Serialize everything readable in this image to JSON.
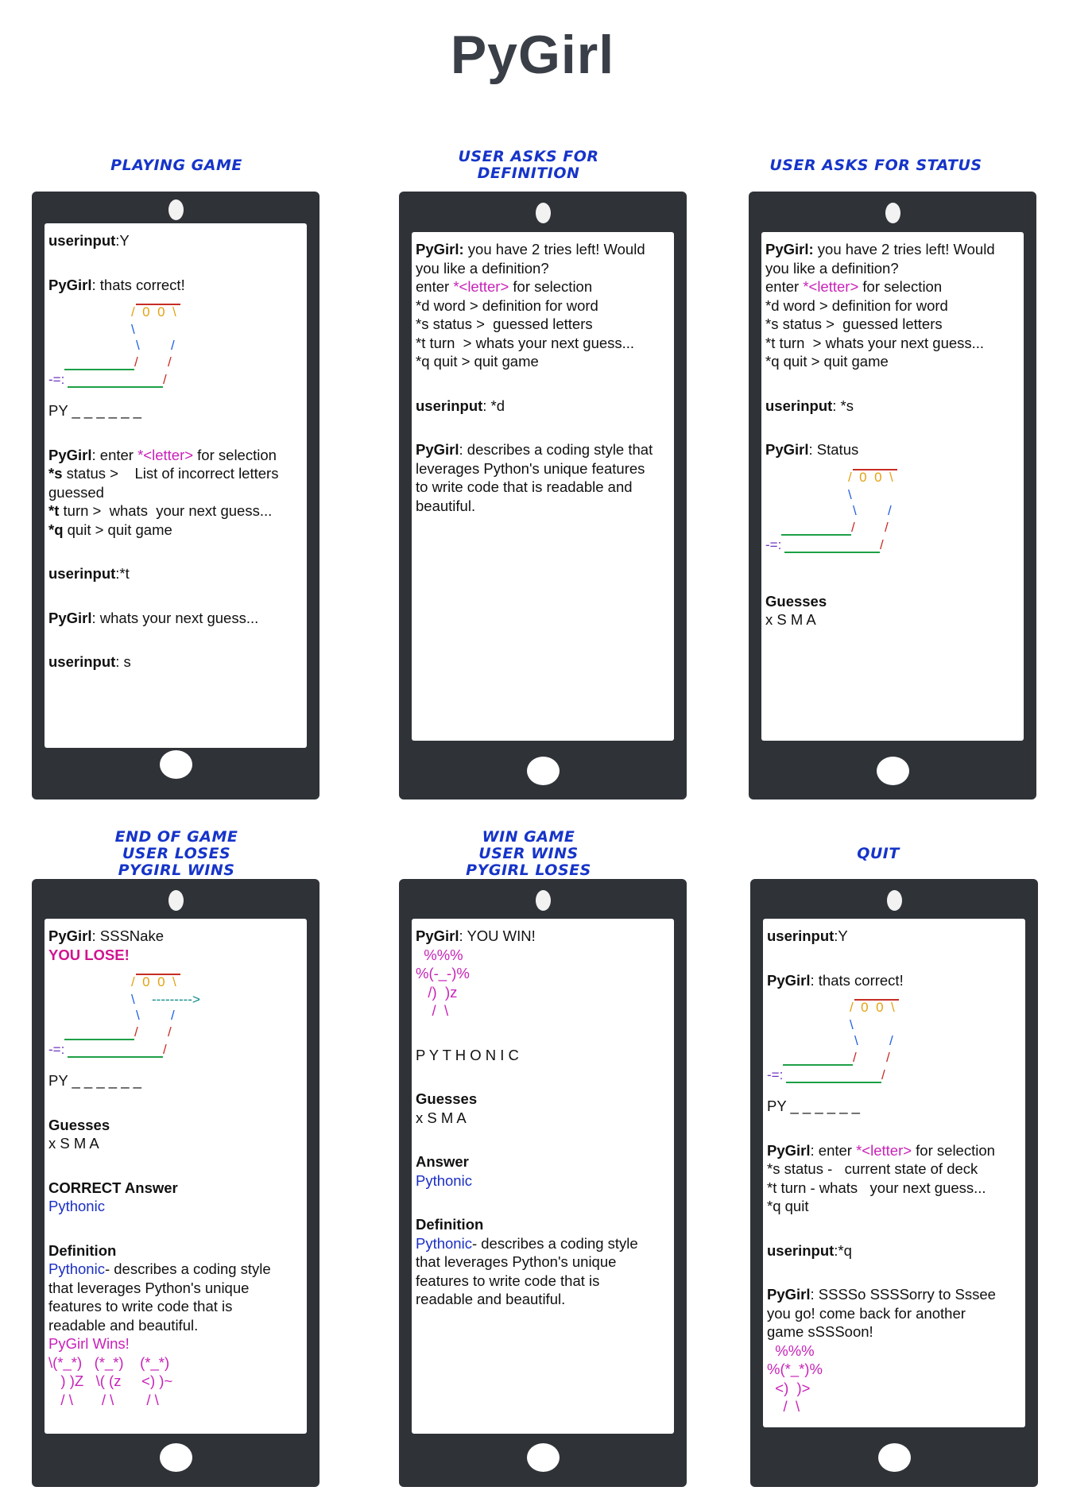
{
  "title": "PyGirl",
  "panels": [
    {
      "caption": [
        "PLAYING GAME"
      ],
      "lines": [
        {
          "t": [
            {
              "s": "userinput",
              "c": "b"
            },
            {
              "s": ":Y"
            }
          ]
        },
        {
          "gap": true
        },
        {
          "t": [
            {
              "s": "PyGirl",
              "c": "b"
            },
            {
              "s": ": thats correct!"
            }
          ]
        },
        {
          "art": "snake"
        },
        {
          "t": [
            {
              "s": "PY _ _ _ _ _ _"
            }
          ]
        },
        {
          "gap": true
        },
        {
          "t": [
            {
              "s": "PyGirl",
              "c": "b"
            },
            {
              "s": ": enter "
            },
            {
              "s": "*<letter>",
              "c": "mag"
            },
            {
              "s": " for selection"
            }
          ]
        },
        {
          "t": [
            {
              "s": "*s",
              "c": "b"
            },
            {
              "s": " status >    List of incorrect letters"
            }
          ]
        },
        {
          "t": [
            {
              "s": "guessed"
            }
          ]
        },
        {
          "t": [
            {
              "s": "*t",
              "c": "b"
            },
            {
              "s": " turn >  whats  your next guess..."
            }
          ]
        },
        {
          "t": [
            {
              "s": "*q",
              "c": "b"
            },
            {
              "s": " quit > quit game"
            }
          ]
        },
        {
          "gap": true
        },
        {
          "t": [
            {
              "s": "userinput",
              "c": "b"
            },
            {
              "s": ":*t"
            }
          ]
        },
        {
          "gap": true
        },
        {
          "t": [
            {
              "s": "PyGirl",
              "c": "b"
            },
            {
              "s": ": whats your next guess..."
            }
          ]
        },
        {
          "gap": true
        },
        {
          "t": [
            {
              "s": "userinput",
              "c": "b"
            },
            {
              "s": ": s"
            }
          ]
        }
      ]
    },
    {
      "caption": [
        "USER ASKS FOR",
        "DEFINITION"
      ],
      "lines": [
        {
          "t": [
            {
              "s": "PyGirl:",
              "c": "b"
            },
            {
              "s": " you have 2 tries left! Would"
            }
          ]
        },
        {
          "t": [
            {
              "s": "you like a definition?"
            }
          ]
        },
        {
          "t": [
            {
              "s": "enter "
            },
            {
              "s": "*<letter>",
              "c": "mag"
            },
            {
              "s": " for selection"
            }
          ]
        },
        {
          "t": [
            {
              "s": "*d word > definition for word"
            }
          ]
        },
        {
          "t": [
            {
              "s": "*s status >  guessed letters"
            }
          ]
        },
        {
          "t": [
            {
              "s": "*t turn  > whats your next guess..."
            }
          ]
        },
        {
          "t": [
            {
              "s": "*q quit > quit game"
            }
          ]
        },
        {
          "gap": true
        },
        {
          "t": [
            {
              "s": "userinput",
              "c": "b"
            },
            {
              "s": ": *d"
            }
          ]
        },
        {
          "gap": true
        },
        {
          "t": [
            {
              "s": "PyGirl",
              "c": "b"
            },
            {
              "s": ": describes a coding style that"
            }
          ]
        },
        {
          "t": [
            {
              "s": "leverages Python's unique features"
            }
          ]
        },
        {
          "t": [
            {
              "s": "to write code that is readable and"
            }
          ]
        },
        {
          "t": [
            {
              "s": "beautiful."
            }
          ]
        }
      ]
    },
    {
      "caption": [
        "USER ASKS FOR STATUS"
      ],
      "lines": [
        {
          "t": [
            {
              "s": "PyGirl:",
              "c": "b"
            },
            {
              "s": " you have 2 tries left! Would"
            }
          ]
        },
        {
          "t": [
            {
              "s": "you like a definition?"
            }
          ]
        },
        {
          "t": [
            {
              "s": "enter "
            },
            {
              "s": "*<letter>",
              "c": "mag"
            },
            {
              "s": " for selection"
            }
          ]
        },
        {
          "t": [
            {
              "s": "*d word > definition for word"
            }
          ]
        },
        {
          "t": [
            {
              "s": "*s status >  guessed letters"
            }
          ]
        },
        {
          "t": [
            {
              "s": "*t turn  > whats your next guess..."
            }
          ]
        },
        {
          "t": [
            {
              "s": "*q quit > quit game"
            }
          ]
        },
        {
          "gap": true
        },
        {
          "t": [
            {
              "s": "userinput",
              "c": "b"
            },
            {
              "s": ": *s"
            }
          ]
        },
        {
          "gap": true
        },
        {
          "t": [
            {
              "s": "PyGirl",
              "c": "b"
            },
            {
              "s": ": Status"
            }
          ]
        },
        {
          "art": "snake"
        },
        {
          "gap": true
        },
        {
          "t": [
            {
              "s": "Guesses",
              "c": "b"
            }
          ]
        },
        {
          "t": [
            {
              "s": "x S M A"
            }
          ]
        }
      ]
    },
    {
      "caption": [
        "END OF GAME",
        "USER LOSES",
        "PYGIRL WINS"
      ],
      "lines": [
        {
          "t": [
            {
              "s": "PyGirl",
              "c": "b"
            },
            {
              "s": ": SSSNake"
            }
          ]
        },
        {
          "t": [
            {
              "s": "YOU LOSE!",
              "c": "lose"
            }
          ]
        },
        {
          "art": "tongue"
        },
        {
          "t": [
            {
              "s": "PY _ _ _ _ _ _"
            }
          ]
        },
        {
          "gap": true
        },
        {
          "t": [
            {
              "s": "Guesses",
              "c": "b"
            }
          ]
        },
        {
          "t": [
            {
              "s": "x S M A"
            }
          ]
        },
        {
          "gap": true
        },
        {
          "t": [
            {
              "s": "CORRECT Answer",
              "c": "b"
            }
          ]
        },
        {
          "t": [
            {
              "s": "Pythonic",
              "c": "blue"
            }
          ]
        },
        {
          "gap": true
        },
        {
          "t": [
            {
              "s": "Definition",
              "c": "b"
            }
          ]
        },
        {
          "t": [
            {
              "s": "Pythonic",
              "c": "blue"
            },
            {
              "s": "- describes a coding style"
            }
          ]
        },
        {
          "t": [
            {
              "s": "that leverages Python's unique"
            }
          ]
        },
        {
          "t": [
            {
              "s": "features to write code that is"
            }
          ]
        },
        {
          "t": [
            {
              "s": "readable and beautiful."
            }
          ]
        },
        {
          "t": [
            {
              "s": "PyGirl Wins!",
              "c": "mag"
            }
          ]
        },
        {
          "t": [
            {
              "s": "\\(*_*)   (*_*)    (*_*)",
              "c": "mag"
            }
          ]
        },
        {
          "t": [
            {
              "s": "   ) )Z   \\( (z     <) )~",
              "c": "mag"
            }
          ]
        },
        {
          "t": [
            {
              "s": "   / \\       / \\        / \\",
              "c": "mag"
            }
          ]
        }
      ]
    },
    {
      "caption": [
        "WIN GAME",
        "USER WINS",
        "PYGIRL LOSES"
      ],
      "lines": [
        {
          "t": [
            {
              "s": "PyGirl",
              "c": "b"
            },
            {
              "s": ": YOU WIN!"
            }
          ]
        },
        {
          "t": [
            {
              "s": "  %%%",
              "c": "mag"
            }
          ]
        },
        {
          "t": [
            {
              "s": "%(-_-)%",
              "c": "mag"
            }
          ]
        },
        {
          "t": [
            {
              "s": "   /)  )z",
              "c": "mag"
            }
          ]
        },
        {
          "t": [
            {
              "s": "    /  \\",
              "c": "mag"
            }
          ]
        },
        {
          "gap": true
        },
        {
          "t": [
            {
              "s": "P Y T H O N I C"
            }
          ]
        },
        {
          "gap": true
        },
        {
          "t": [
            {
              "s": "Guesses",
              "c": "b"
            }
          ]
        },
        {
          "t": [
            {
              "s": "x S M A"
            }
          ]
        },
        {
          "gap": true
        },
        {
          "t": [
            {
              "s": "Answer",
              "c": "b"
            }
          ]
        },
        {
          "t": [
            {
              "s": "Pythonic",
              "c": "blue"
            }
          ]
        },
        {
          "gap": true
        },
        {
          "t": [
            {
              "s": "Definition",
              "c": "b"
            }
          ]
        },
        {
          "t": [
            {
              "s": "Pythonic",
              "c": "blue"
            },
            {
              "s": "- describes a coding style"
            }
          ]
        },
        {
          "t": [
            {
              "s": "that leverages Python's unique"
            }
          ]
        },
        {
          "t": [
            {
              "s": "features to write code that is"
            }
          ]
        },
        {
          "t": [
            {
              "s": "readable and beautiful."
            }
          ]
        }
      ]
    },
    {
      "caption": [
        "QUIT"
      ],
      "lines": [
        {
          "t": [
            {
              "s": "userinput",
              "c": "b"
            },
            {
              "s": ":Y"
            }
          ]
        },
        {
          "gap": true
        },
        {
          "t": [
            {
              "s": "PyGirl",
              "c": "b"
            },
            {
              "s": ": thats correct!"
            }
          ]
        },
        {
          "art": "snake"
        },
        {
          "t": [
            {
              "s": "PY _ _ _ _ _ _"
            }
          ]
        },
        {
          "gap": true
        },
        {
          "t": [
            {
              "s": "PyGirl",
              "c": "b"
            },
            {
              "s": ": enter "
            },
            {
              "s": "*<letter>",
              "c": "mag"
            },
            {
              "s": " for selection"
            }
          ]
        },
        {
          "t": [
            {
              "s": "*s status -   current state of deck"
            }
          ]
        },
        {
          "t": [
            {
              "s": "*t turn - whats   your next guess..."
            }
          ]
        },
        {
          "t": [
            {
              "s": "*q quit"
            }
          ]
        },
        {
          "gap": true
        },
        {
          "t": [
            {
              "s": "userinput",
              "c": "b"
            },
            {
              "s": ":*q"
            }
          ]
        },
        {
          "gap": true
        },
        {
          "t": [
            {
              "s": "PyGirl",
              "c": "b"
            },
            {
              "s": ": SSSSo SSSSorry to Sssee"
            }
          ]
        },
        {
          "t": [
            {
              "s": "you go! come back for another"
            }
          ]
        },
        {
          "t": [
            {
              "s": "game sSSSoon!"
            }
          ]
        },
        {
          "t": [
            {
              "s": "  %%%",
              "c": "mag"
            }
          ]
        },
        {
          "t": [
            {
              "s": "%(*_*)%",
              "c": "mag"
            }
          ]
        },
        {
          "t": [
            {
              "s": "  <)  )>",
              "c": "mag"
            }
          ]
        },
        {
          "t": [
            {
              "s": "    /  \\",
              "c": "mag"
            }
          ]
        }
      ]
    }
  ],
  "art": {
    "head": "/  0  0  \\",
    "neck": "\\",
    "tongue": "--------->",
    "bodyL": "\\",
    "bodyR": "/",
    "turnL": "/",
    "turnR": "/",
    "tail": "-=:",
    "colors": {
      "yellow": "#e3a212",
      "blue": "#1f5fe0",
      "red": "#c62d24",
      "green": "#1da046",
      "purple": "#6f35c0",
      "teal": "#0e8a8a"
    }
  }
}
